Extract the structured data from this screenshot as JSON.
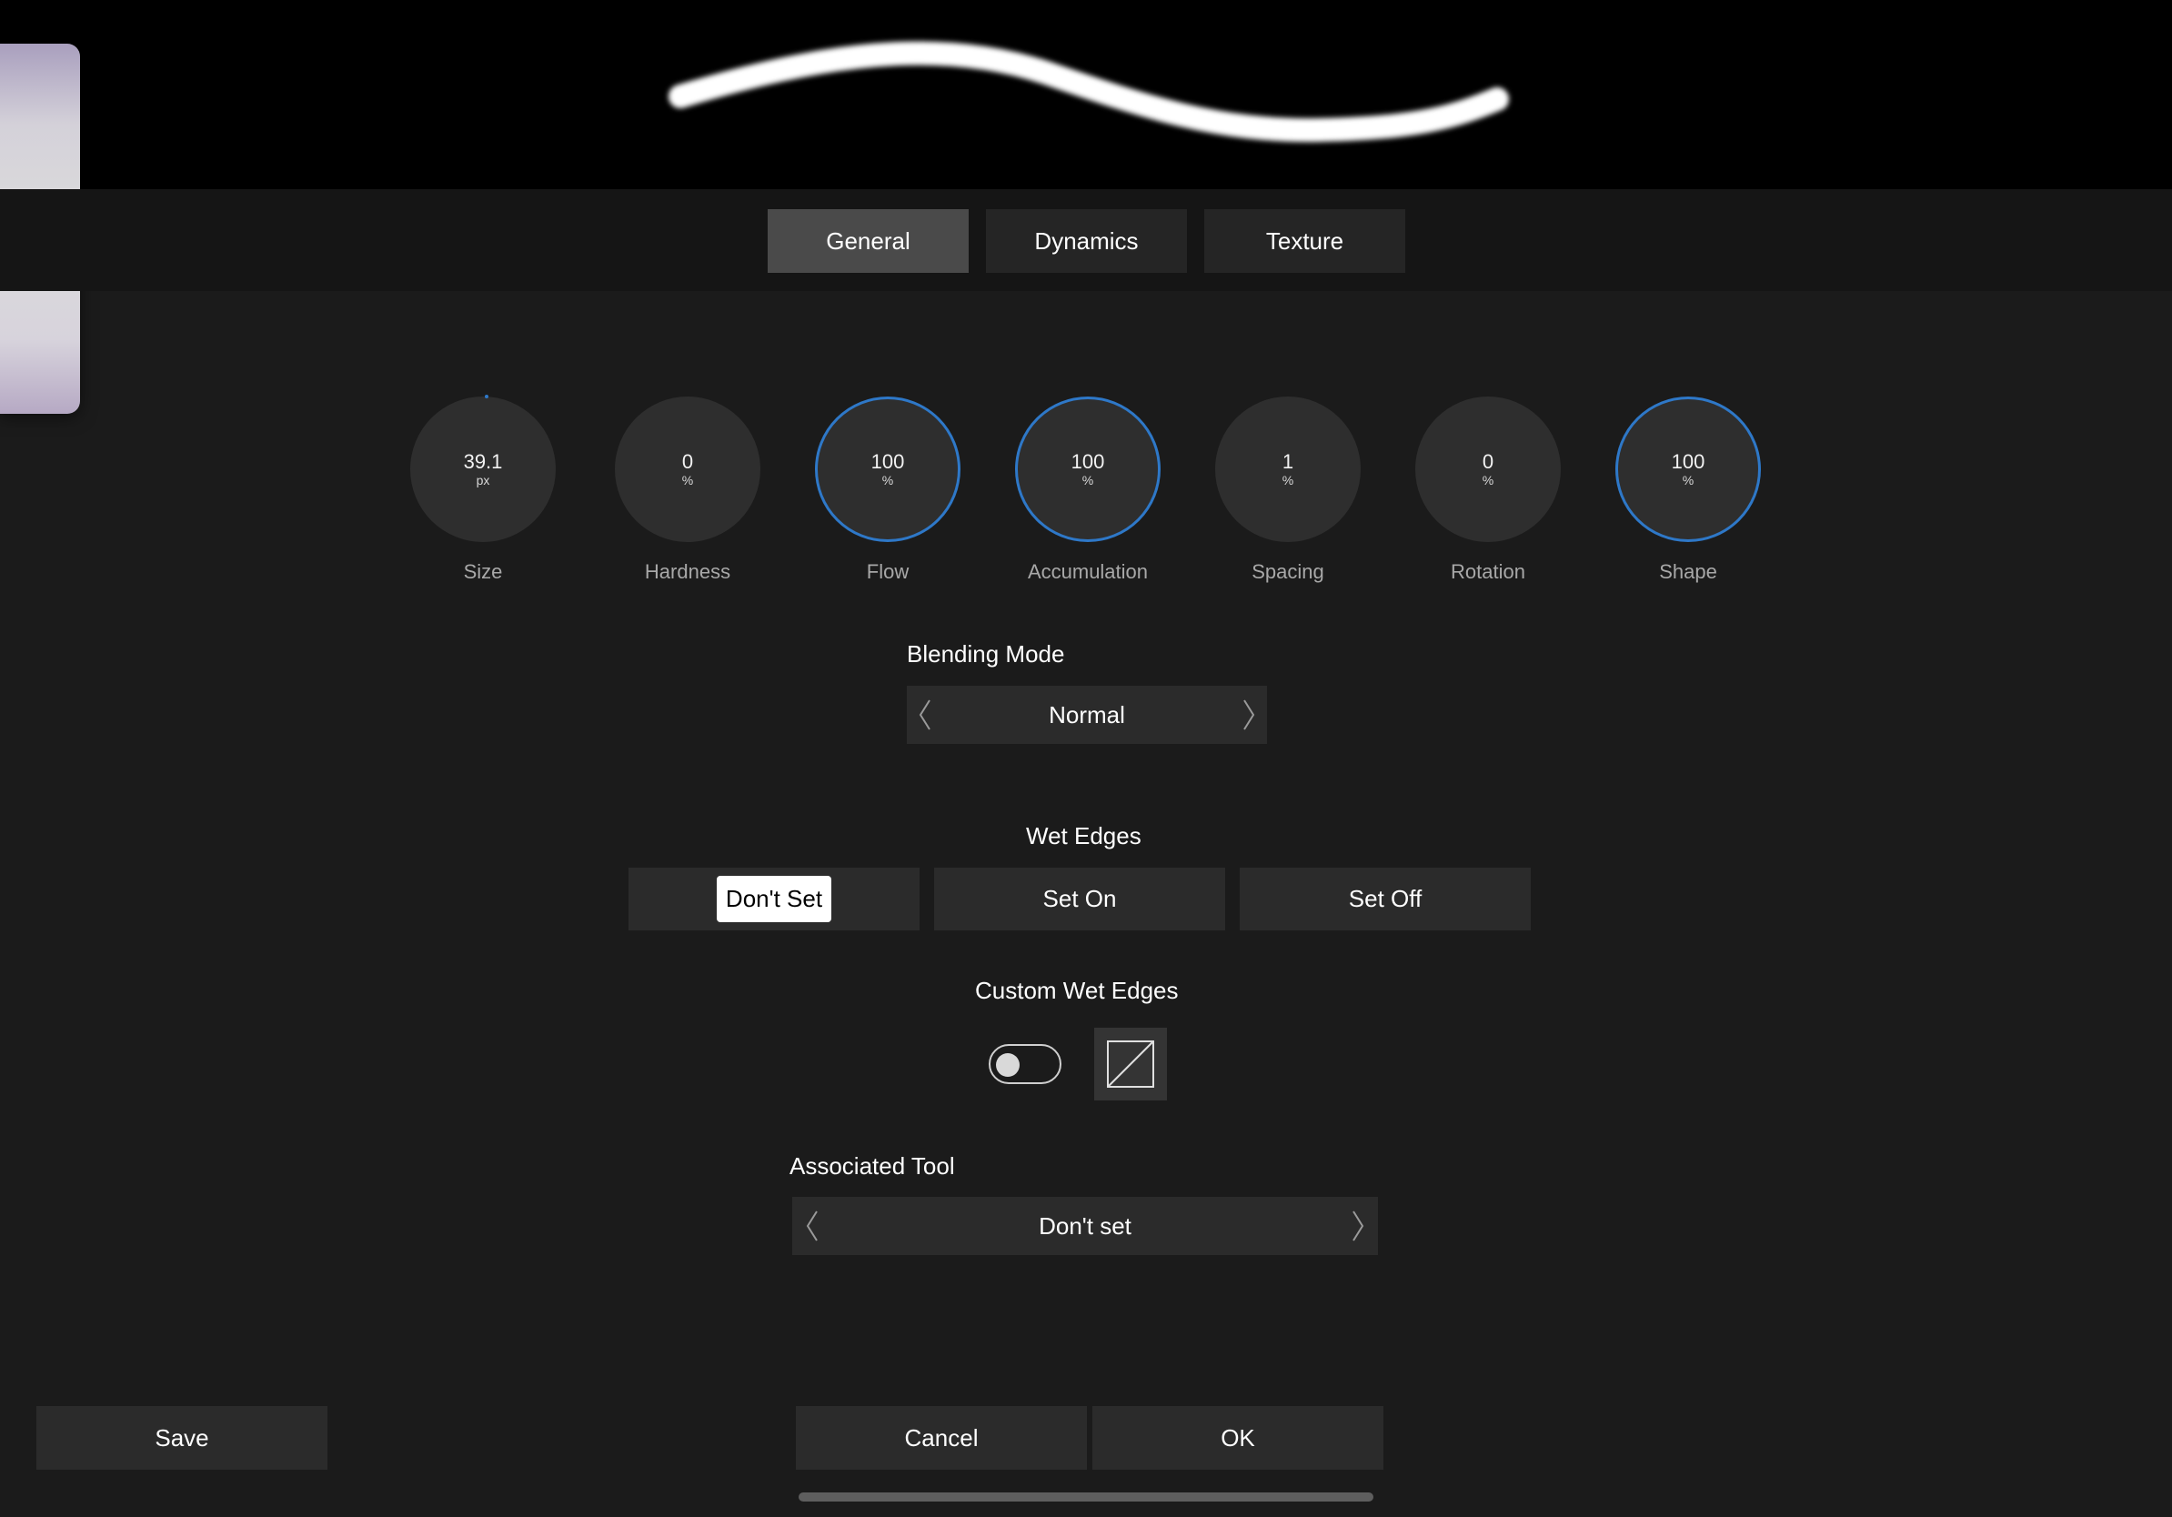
{
  "tabs": [
    {
      "label": "General",
      "active": true
    },
    {
      "label": "Dynamics",
      "active": false
    },
    {
      "label": "Texture",
      "active": false
    }
  ],
  "icons": {
    "side_handle": "chevron-right-icon",
    "blending_prev": "chevron-left-icon",
    "blending_next": "chevron-right-icon",
    "tool_prev": "chevron-left-icon",
    "tool_next": "chevron-right-icon",
    "curve": "curve-graph-icon"
  },
  "dials": [
    {
      "label": "Size",
      "value": "39.1",
      "unit": "px",
      "ring": false
    },
    {
      "label": "Hardness",
      "value": "0",
      "unit": "%",
      "ring": false
    },
    {
      "label": "Flow",
      "value": "100",
      "unit": "%",
      "ring": true
    },
    {
      "label": "Accumulation",
      "value": "100",
      "unit": "%",
      "ring": true
    },
    {
      "label": "Spacing",
      "value": "1",
      "unit": "%",
      "ring": false
    },
    {
      "label": "Rotation",
      "value": "0",
      "unit": "%",
      "ring": false
    },
    {
      "label": "Shape",
      "value": "100",
      "unit": "%",
      "ring": true
    }
  ],
  "blending": {
    "title": "Blending Mode",
    "value": "Normal"
  },
  "wet_edges": {
    "title": "Wet Edges",
    "options": [
      "Don't Set",
      "Set On",
      "Set Off"
    ],
    "selected": "Don't Set"
  },
  "custom_wet_edges": {
    "title": "Custom Wet Edges",
    "enabled": false
  },
  "associated_tool": {
    "title": "Associated Tool",
    "value": "Don't set"
  },
  "footer": {
    "save": "Save",
    "cancel": "Cancel",
    "ok": "OK"
  },
  "colors": {
    "background": "#1b1b1b",
    "accent_ring": "#2e78c8",
    "active_tab": "#4a4a4a",
    "control": "#2b2b2b"
  }
}
